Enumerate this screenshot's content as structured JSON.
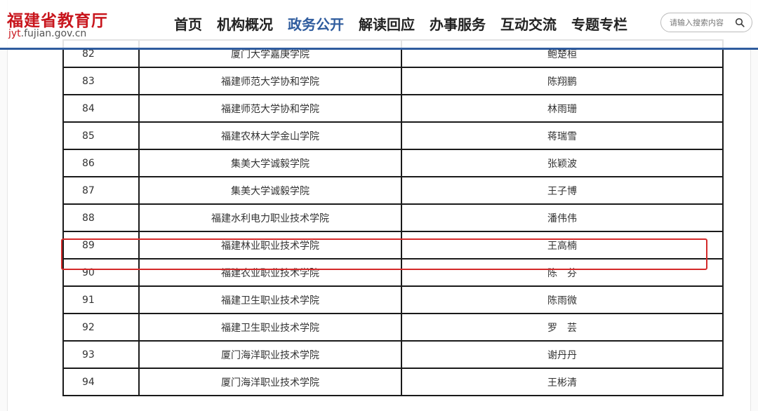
{
  "header": {
    "site_title": "福建省教育厅",
    "domain_prefix": "jyt",
    "domain_suffix": ".fujian.gov.cn",
    "nav": [
      {
        "label": "首页",
        "active": false
      },
      {
        "label": "机构概况",
        "active": false
      },
      {
        "label": "政务公开",
        "active": true
      },
      {
        "label": "解读回应",
        "active": false
      },
      {
        "label": "办事服务",
        "active": false
      },
      {
        "label": "互动交流",
        "active": false
      },
      {
        "label": "专题专栏",
        "active": false
      }
    ],
    "search": {
      "placeholder": "请输入搜索内容",
      "icon": "search-icon"
    },
    "accent_color": "#2f5c9e",
    "brand_color": "#c8161d"
  },
  "table": {
    "rows": [
      {
        "no": "82",
        "school": "厦门大学嘉庚学院",
        "name": "鲍楚桓"
      },
      {
        "no": "83",
        "school": "福建师范大学协和学院",
        "name": "陈翔鹏"
      },
      {
        "no": "84",
        "school": "福建师范大学协和学院",
        "name": "林雨珊"
      },
      {
        "no": "85",
        "school": "福建农林大学金山学院",
        "name": "蒋瑞雪"
      },
      {
        "no": "86",
        "school": "集美大学诚毅学院",
        "name": "张颖波"
      },
      {
        "no": "87",
        "school": "集美大学诚毅学院",
        "name": "王子博"
      },
      {
        "no": "88",
        "school": "福建水利电力职业技术学院",
        "name": "潘伟伟"
      },
      {
        "no": "89",
        "school": "福建林业职业技术学院",
        "name": "王高楠",
        "highlighted": true
      },
      {
        "no": "90",
        "school": "福建农业职业技术学院",
        "name": "陈　芬"
      },
      {
        "no": "91",
        "school": "福建卫生职业技术学院",
        "name": "陈雨微"
      },
      {
        "no": "92",
        "school": "福建卫生职业技术学院",
        "name": "罗　芸"
      },
      {
        "no": "93",
        "school": "厦门海洋职业技术学院",
        "name": "谢丹丹"
      },
      {
        "no": "94",
        "school": "厦门海洋职业技术学院",
        "name": "王彬清"
      }
    ],
    "highlight_color": "#d42a2a"
  }
}
